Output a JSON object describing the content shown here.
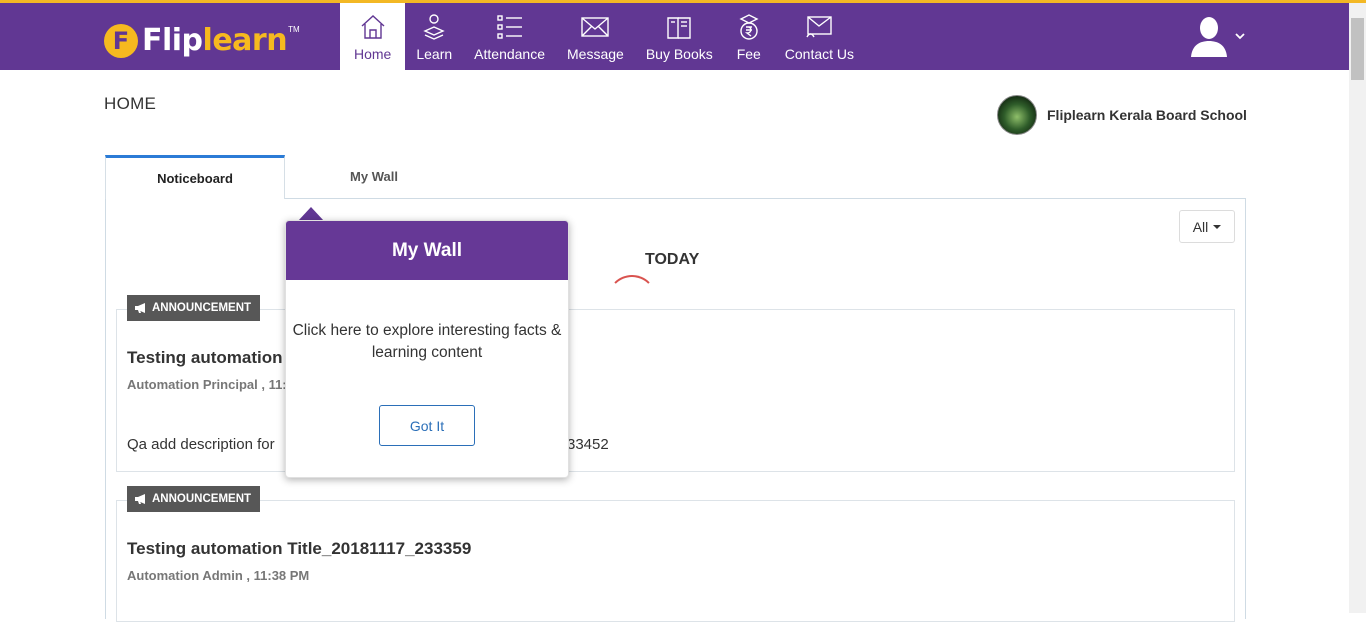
{
  "brand": {
    "logo_letter": "F",
    "name_part1": "Flip",
    "name_part2": "learn",
    "tm": "TM"
  },
  "nav": [
    {
      "label": "Home",
      "icon": "home-icon",
      "active": true
    },
    {
      "label": "Learn",
      "icon": "learn-icon",
      "active": false
    },
    {
      "label": "Attendance",
      "icon": "attendance-icon",
      "active": false
    },
    {
      "label": "Message",
      "icon": "message-icon",
      "active": false
    },
    {
      "label": "Buy Books",
      "icon": "books-icon",
      "active": false
    },
    {
      "label": "Fee",
      "icon": "fee-icon",
      "active": false
    },
    {
      "label": "Contact Us",
      "icon": "contact-icon",
      "active": false
    }
  ],
  "page": {
    "title": "HOME",
    "school_name": "Fliplearn Kerala Board School"
  },
  "tabs": [
    {
      "label": "Noticeboard",
      "active": true
    },
    {
      "label": "My Wall",
      "active": false
    }
  ],
  "filter": {
    "value": "All"
  },
  "feed": {
    "section_label": "TODAY",
    "items": [
      {
        "badge": "ANNOUNCEMENT",
        "title": "Testing automation",
        "meta": "Automation Principal , 11:3",
        "description": "Qa add description for",
        "description_tail": "33452"
      },
      {
        "badge": "ANNOUNCEMENT",
        "title": "Testing automation Title_20181117_233359",
        "meta": "Automation Admin , 11:38 PM"
      }
    ]
  },
  "popover": {
    "title": "My Wall",
    "body": "Click here to explore interesting facts & learning content",
    "button": "Got It"
  },
  "colors": {
    "header_bg": "#613793",
    "accent_yellow": "#f6b91f",
    "tab_active_border": "#2b7bd6",
    "badge_bg": "#575757",
    "spinner": "#d9534f"
  }
}
